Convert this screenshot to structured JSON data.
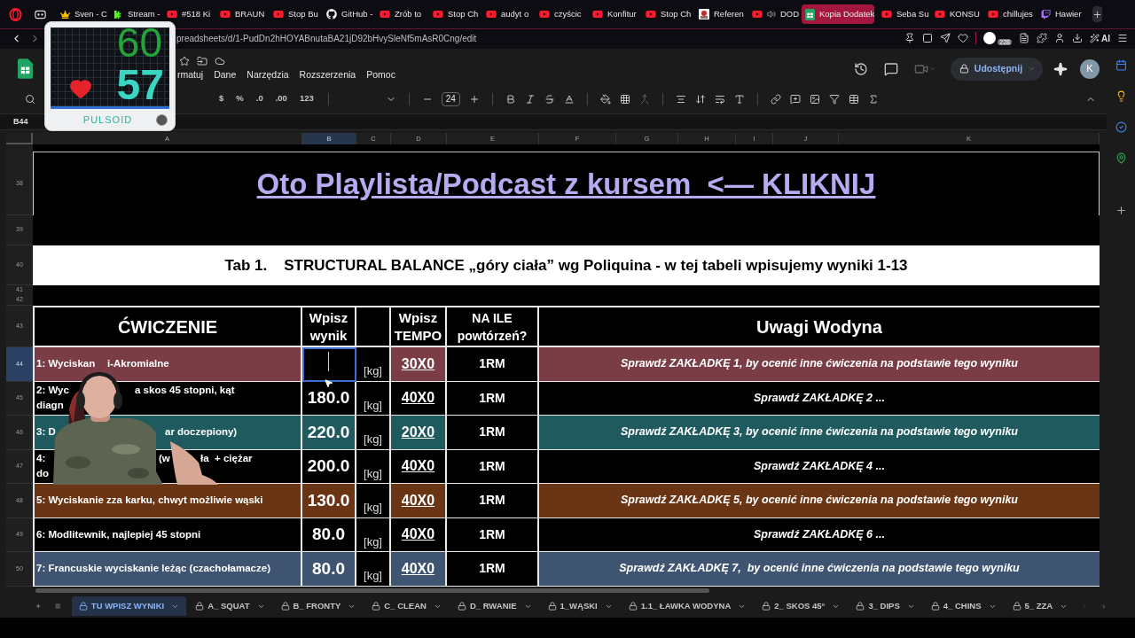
{
  "browser": {
    "tabs": [
      {
        "label": "Sven - C",
        "kind": "crown",
        "selected": false,
        "audio": false
      },
      {
        "label": "Stream -",
        "kind": "kick",
        "selected": false,
        "audio": false
      },
      {
        "label": "#518 Ki",
        "kind": "youtube",
        "selected": false,
        "audio": false
      },
      {
        "label": "BRAUN",
        "kind": "youtube",
        "selected": false,
        "audio": false
      },
      {
        "label": "Stop Bu",
        "kind": "youtube",
        "selected": false,
        "audio": false
      },
      {
        "label": "GitHub -",
        "kind": "github",
        "selected": false,
        "audio": false
      },
      {
        "label": "Zrób to",
        "kind": "youtube",
        "selected": false,
        "audio": false
      },
      {
        "label": "Stop Ch",
        "kind": "youtube",
        "selected": false,
        "audio": false
      },
      {
        "label": "audyt o",
        "kind": "youtube",
        "selected": false,
        "audio": false
      },
      {
        "label": "czyścic",
        "kind": "youtube",
        "selected": false,
        "audio": false
      },
      {
        "label": "Konfitur",
        "kind": "youtube",
        "selected": false,
        "audio": false
      },
      {
        "label": "Stop Ch",
        "kind": "youtube",
        "selected": false,
        "audio": false
      },
      {
        "label": "Referen",
        "selected": false,
        "audio": false
      },
      {
        "label": "DOD",
        "kind": "youtube",
        "selected": false,
        "audio": true
      },
      {
        "label": "Kopia Dodatek",
        "kind": "sheets",
        "selected": true,
        "audio": false
      },
      {
        "label": "Seba Su",
        "kind": "youtube",
        "selected": false,
        "audio": false
      },
      {
        "label": "KONSU",
        "kind": "youtube",
        "selected": false,
        "audio": false
      },
      {
        "label": "chillujes",
        "kind": "youtube",
        "selected": false,
        "audio": false
      },
      {
        "label": "Hawier",
        "kind": "twitch",
        "selected": false,
        "audio": false
      }
    ],
    "url": "preadsheets/d/1-PudDn2hHOYABnutaBA21jD92bHvySleNf5mAsR0Cng/edit",
    "extension_badge": "228",
    "ai_label": "AI"
  },
  "pulse_widget": {
    "top_reading": "60",
    "bpm": "57",
    "brand": "PULSOID"
  },
  "doc": {
    "menu": [
      "rmatuj",
      "Dane",
      "Narzędzia",
      "Rozszerzenia",
      "Pomoc"
    ],
    "share": "Udostępnij",
    "avatar": "K"
  },
  "toolbar": {
    "number_formats": [
      "$",
      "%",
      ".0",
      ".00",
      "123"
    ],
    "font_size": "24"
  },
  "name_box": "B44",
  "columns": [
    {
      "label": "A",
      "selected": false
    },
    {
      "label": "B",
      "selected": true
    },
    {
      "label": "C",
      "selected": false
    },
    {
      "label": "D",
      "selected": false
    },
    {
      "label": "E",
      "selected": false
    },
    {
      "label": "F",
      "selected": false
    },
    {
      "label": "G",
      "selected": false
    },
    {
      "label": "H",
      "selected": false
    },
    {
      "label": "I",
      "selected": false
    },
    {
      "label": "J",
      "selected": false
    },
    {
      "label": "K",
      "selected": false
    }
  ],
  "grid_rows": [
    {
      "kind": "link",
      "number": "38",
      "text": "Oto Playlista/Podcast z kursem  <— KLIKNIJ"
    },
    {
      "kind": "blank",
      "number": "39"
    },
    {
      "kind": "title",
      "number": "40",
      "text": "Tab 1.    STRUCTURAL BALANCE „góry ciała” wg Poliquina - w tej tabeli wpisujemy wyniki 1-13"
    },
    {
      "kind": "blank",
      "number": "41"
    },
    {
      "kind": "blank",
      "number": "42"
    },
    {
      "kind": "header",
      "number": "43",
      "cells": [
        "ĆWICZENIE",
        "Wpisz wynik",
        "Wpisz TEMPO",
        "NA ILE powtórzeń?",
        "Uwagi Wodyna"
      ]
    },
    {
      "kind": "exercise",
      "number": "44",
      "selected": true,
      "color": "#7a3d46",
      "label_lines": [
        [
          "1: Wyciskan",
          "i-Akromialne"
        ]
      ],
      "unit": "[kg]",
      "tempo": "30X0",
      "reps": "1RM",
      "note": "Sprawdź ZAKŁADKĘ 1, by ocenić inne ćwiczenia na podstawie tego wyniku"
    },
    {
      "kind": "exercise",
      "number": "45",
      "selected": false,
      "label_lines": [
        [
          "2: Wyc",
          "a skos 45 stopni, kąt"
        ],
        [
          "diagn"
        ]
      ],
      "value": "180.0",
      "unit": "[kg]",
      "tempo": "40X0",
      "reps": "1RM",
      "note": "Sprawdź ZAKŁADKĘ 2 ..."
    },
    {
      "kind": "exercise",
      "number": "46",
      "selected": false,
      "color": "#1e5a5e",
      "label_lines": [
        [
          "3: D",
          "ar doczepiony)"
        ]
      ],
      "value": "220.0",
      "unit": "[kg]",
      "tempo": "20X0",
      "reps": "1RM",
      "note": "Sprawdź ZAKŁADKĘ 3, by ocenić inne ćwiczenia na podstawie tego wyniku"
    },
    {
      "kind": "exercise",
      "number": "47",
      "selected": false,
      "label_lines": [
        [
          "4:",
          "(w",
          "ła  + ciężar"
        ],
        [
          "do"
        ]
      ],
      "value": "200.0",
      "unit": "[kg]",
      "tempo": "40X0",
      "reps": "1RM",
      "note": "Sprawdź ZAKŁADKĘ 4 ..."
    },
    {
      "kind": "exercise",
      "number": "48",
      "selected": false,
      "color": "#6a3514",
      "label_lines": [
        [
          "5: Wyciskanie zza karku, chwyt możliwie wąski"
        ]
      ],
      "value": "130.0",
      "unit": "[kg]",
      "tempo": "40X0",
      "reps": "1RM",
      "note": "Sprawdź ZAKŁADKĘ 5, by ocenić inne ćwiczenia na podstawie tego wyniku"
    },
    {
      "kind": "exercise",
      "number": "49",
      "selected": false,
      "label_lines": [
        [
          "6: Modlitewnik, najlepiej 45 stopni"
        ]
      ],
      "value": "80.0",
      "unit": "[kg]",
      "tempo": "40X0",
      "reps": "1RM",
      "note": "Sprawdź ZAKŁADKĘ 6 ..."
    },
    {
      "kind": "exercise",
      "number": "50",
      "selected": false,
      "color": "#3e5470",
      "label_lines": [
        [
          "7: Francuskie wyciskanie leżąc (czachołamacze)"
        ]
      ],
      "value": "80.0",
      "unit": "[kg]",
      "tempo": "40X0",
      "reps": "1RM",
      "note": "Sprawdź ZAKŁADKĘ 7,  by ocenić inne ćwiczenia na podstawie tego wyniku"
    }
  ],
  "sheet_tabs": [
    {
      "label": "TU WPISZ WYNIKI",
      "locked": true,
      "selected": true
    },
    {
      "label": "A_ SQUAT",
      "locked": true,
      "selected": false
    },
    {
      "label": "B_ FRONTY",
      "locked": true,
      "selected": false
    },
    {
      "label": "C_ CLEAN",
      "locked": true,
      "selected": false
    },
    {
      "label": "D_ RWANIE",
      "locked": true,
      "selected": false
    },
    {
      "label": "1_WĄSKI",
      "locked": true,
      "selected": false
    },
    {
      "label": "1.1_ ŁAWKA WODYNA",
      "locked": true,
      "selected": false
    },
    {
      "label": "2_ SKOS 45°",
      "locked": true,
      "selected": false
    },
    {
      "label": "3_ DIPS",
      "locked": true,
      "selected": false
    },
    {
      "label": "4_ CHINS",
      "locked": true,
      "selected": false
    },
    {
      "label": "5_ ZZA",
      "locked": true,
      "selected": false
    }
  ]
}
